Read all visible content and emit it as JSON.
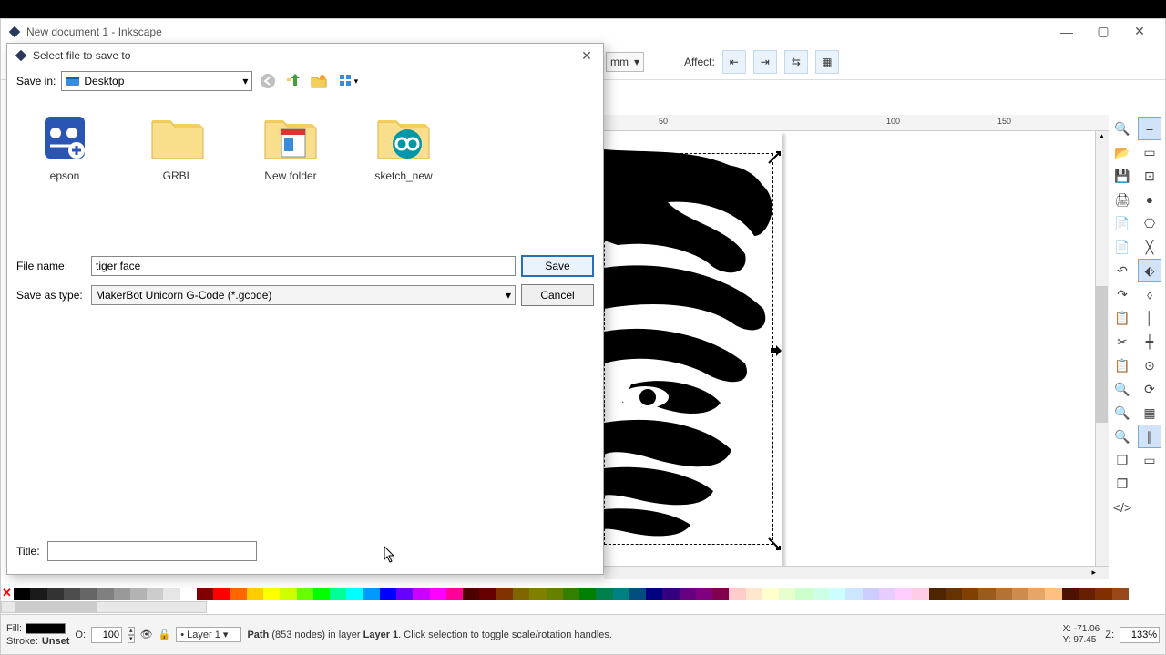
{
  "window": {
    "title": "New document 1 - Inkscape",
    "controls": {
      "min": "—",
      "max": "▢",
      "close": "✕"
    }
  },
  "toolbar": {
    "unit": "mm",
    "affect_label": "Affect:"
  },
  "ruler": {
    "ticks": [
      "50",
      "100",
      "150"
    ]
  },
  "statusbar": {
    "fill_label": "Fill:",
    "stroke_label": "Stroke:",
    "stroke_value": "Unset",
    "opacity_label": "O:",
    "opacity_value": "100",
    "layer_value": "Layer 1",
    "status_prefix": "Path",
    "status_nodes": " (853 nodes) in layer ",
    "status_layer": "Layer 1",
    "status_suffix": ". Click selection to toggle scale/rotation handles.",
    "x_label": "X:",
    "x_value": "-71.06",
    "y_label": "Y:",
    "y_value": "97.45",
    "z_label": "Z:",
    "zoom_value": "133%"
  },
  "dialog": {
    "title": "Select file to save to",
    "close": "✕",
    "savein_label": "Save in:",
    "savein_value": "Desktop",
    "files": [
      {
        "name": "epson",
        "type": "folder-blue"
      },
      {
        "name": "GRBL",
        "type": "folder"
      },
      {
        "name": "New folder",
        "type": "folder-doc"
      },
      {
        "name": "sketch_new",
        "type": "folder-arduino"
      }
    ],
    "filename_label": "File name:",
    "filename_value": "tiger face",
    "savetype_label": "Save as type:",
    "savetype_value": "MakerBot Unicorn G-Code (*.gcode)",
    "save_label": "Save",
    "cancel_label": "Cancel",
    "title_label": "Title:",
    "title_value": ""
  },
  "palette": [
    "#000000",
    "#1a1a1a",
    "#333333",
    "#4d4d4d",
    "#666666",
    "#808080",
    "#999999",
    "#b3b3b3",
    "#cccccc",
    "#e6e6e6",
    "#ffffff",
    "#800000",
    "#ff0000",
    "#ff6600",
    "#ffcc00",
    "#ffff00",
    "#ccff00",
    "#66ff00",
    "#00ff00",
    "#00ff99",
    "#00ffff",
    "#0099ff",
    "#0000ff",
    "#6600ff",
    "#cc00ff",
    "#ff00ff",
    "#ff0099",
    "#4d0000",
    "#660000",
    "#803300",
    "#806600",
    "#808000",
    "#668000",
    "#338000",
    "#008000",
    "#00804d",
    "#008080",
    "#004d80",
    "#000080",
    "#330080",
    "#660080",
    "#800080",
    "#80004d",
    "#ffcccc",
    "#ffe6cc",
    "#ffffcc",
    "#e6ffcc",
    "#ccffcc",
    "#ccffe6",
    "#ccffff",
    "#cce6ff",
    "#ccccff",
    "#e6ccff",
    "#ffccff",
    "#ffcce6",
    "#4d2600",
    "#663300",
    "#804000",
    "#995c1a",
    "#b37333",
    "#cc8c4d",
    "#e6a666",
    "#ffc080",
    "#4d1300",
    "#662000",
    "#803000",
    "#99471a"
  ],
  "right_tools_left": [
    "zoom-in-icon",
    "open-icon",
    "save-icon",
    "print-icon",
    "import-icon",
    "export-icon",
    "undo-icon",
    "redo-icon",
    "copy-icon",
    "cut-icon",
    "paste-icon",
    "zoom-sel-icon",
    "zoom-draw-icon",
    "zoom-page-icon",
    "duplicate-icon",
    "clone-icon",
    "xml-icon"
  ],
  "right_tools_right": [
    "snap-toggle",
    "snap-bbox",
    "snap-edges",
    "snap-node",
    "snap-path",
    "snap-intersect",
    "snap-cusp",
    "snap-smooth",
    "snap-line",
    "snap-midpoint",
    "snap-center",
    "snap-rotation",
    "snap-grid",
    "snap-guide",
    "snap-page"
  ]
}
